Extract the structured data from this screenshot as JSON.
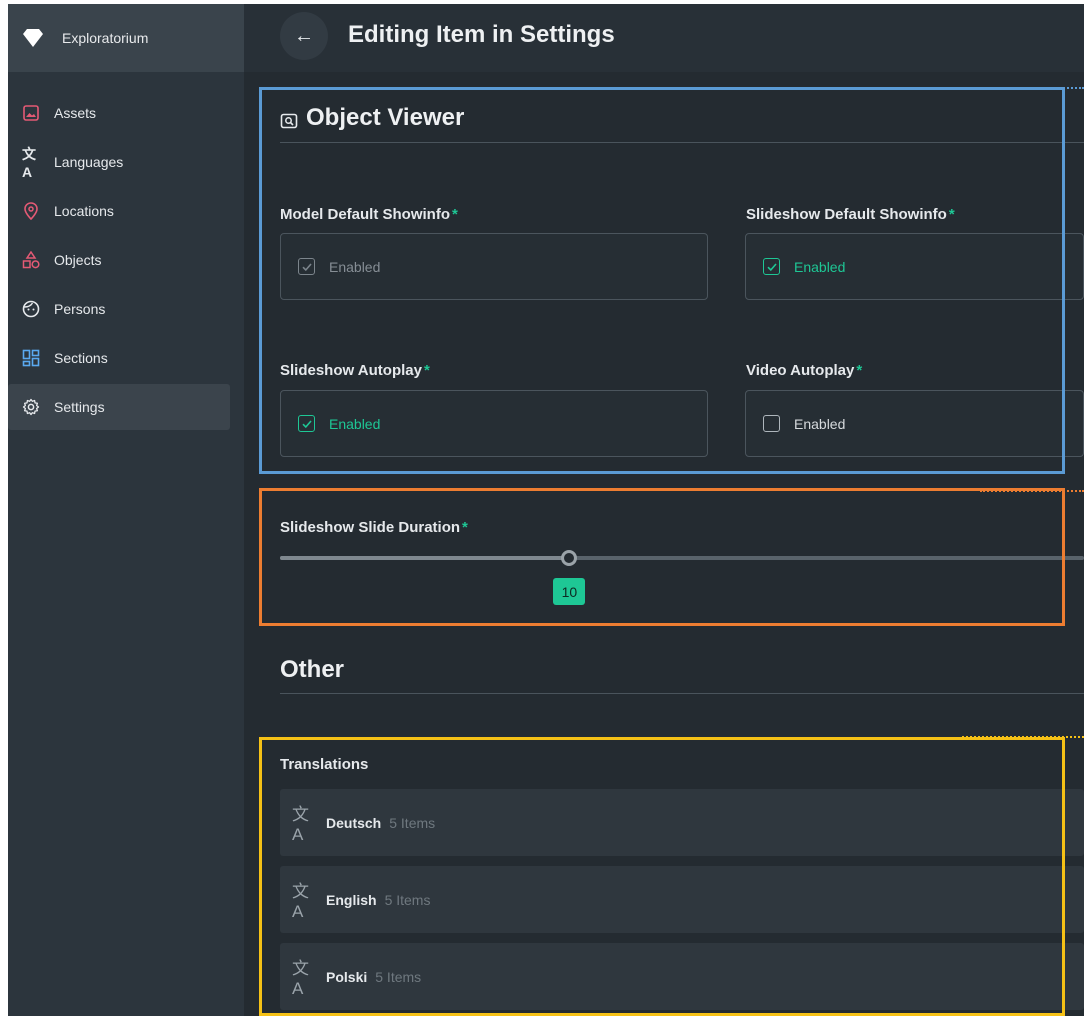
{
  "sidebar": {
    "brand": "Exploratorium",
    "items": [
      {
        "label": "Assets"
      },
      {
        "label": "Languages"
      },
      {
        "label": "Locations"
      },
      {
        "label": "Objects"
      },
      {
        "label": "Persons"
      },
      {
        "label": "Sections"
      },
      {
        "label": "Settings"
      }
    ]
  },
  "header": {
    "title": "Editing Item in Settings"
  },
  "object_viewer": {
    "title": "Object Viewer",
    "fields": [
      {
        "label": "Model Default Showinfo",
        "value": "Enabled",
        "checked": true,
        "disabled": true
      },
      {
        "label": "Slideshow Default Showinfo",
        "value": "Enabled",
        "checked": true,
        "disabled": false
      },
      {
        "label": "Slideshow Autoplay",
        "value": "Enabled",
        "checked": true,
        "disabled": false
      },
      {
        "label": "Video Autoplay",
        "value": "Enabled",
        "checked": false,
        "disabled": false
      }
    ]
  },
  "slider": {
    "label": "Slideshow Slide Duration",
    "value": "10",
    "fraction": 0.36
  },
  "other": {
    "title": "Other"
  },
  "translations": {
    "title": "Translations",
    "items": [
      {
        "lang": "Deutsch",
        "count": "5 Items"
      },
      {
        "lang": "English",
        "count": "5 Items"
      },
      {
        "lang": "Polski",
        "count": "5 Items"
      }
    ]
  },
  "required_mark": "*",
  "colors": {
    "accent": "#1ec795",
    "overlay_blue": "#5b9bd5",
    "overlay_orange": "#ed7d31",
    "overlay_yellow": "#f5c116"
  }
}
